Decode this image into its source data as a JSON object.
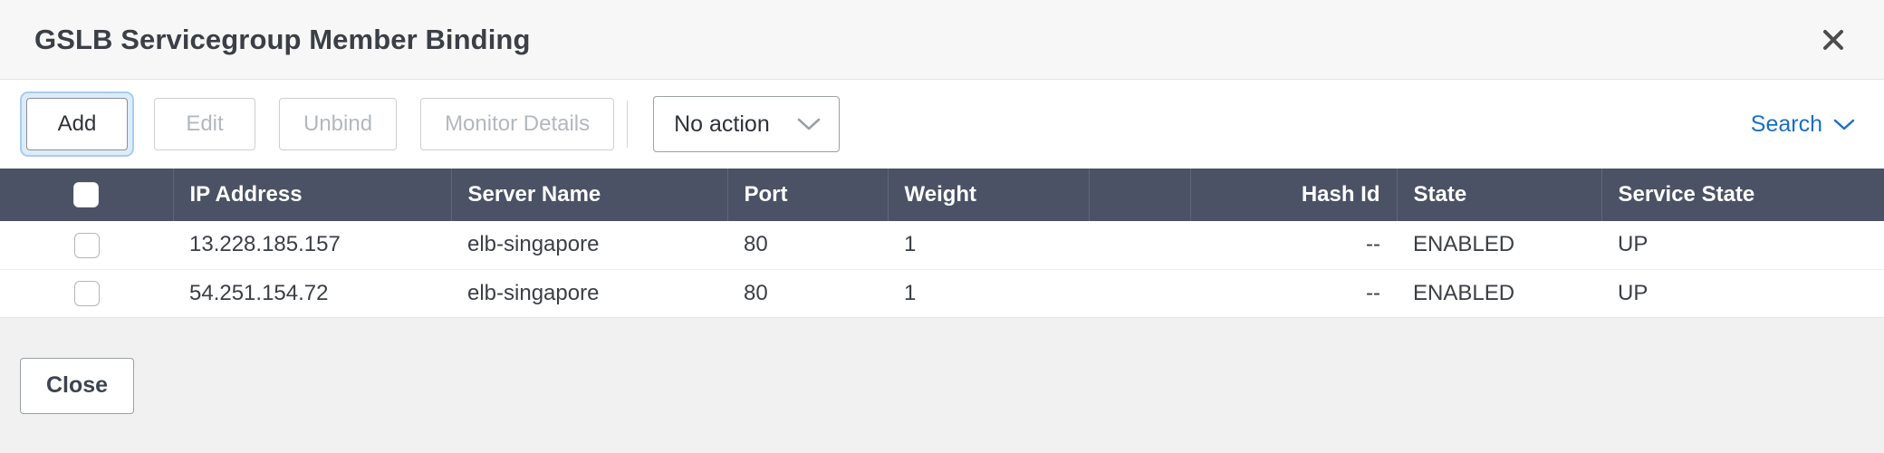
{
  "dialog": {
    "title": "GSLB Servicegroup Member Binding",
    "close_icon": "close-icon"
  },
  "toolbar": {
    "add_label": "Add",
    "edit_label": "Edit",
    "unbind_label": "Unbind",
    "monitor_details_label": "Monitor Details",
    "action_select_value": "No action",
    "action_select_options": [
      "No action"
    ],
    "search_label": "Search",
    "search_chevron_icon": "chevron-down-icon",
    "select_chevron_icon": "chevron-down-icon"
  },
  "table": {
    "columns": [
      {
        "key": "select",
        "label": "",
        "align": "center"
      },
      {
        "key": "ip_address",
        "label": "IP Address",
        "align": "left"
      },
      {
        "key": "server_name",
        "label": "Server Name",
        "align": "left"
      },
      {
        "key": "port",
        "label": "Port",
        "align": "left"
      },
      {
        "key": "weight",
        "label": "Weight",
        "align": "left"
      },
      {
        "key": "blank",
        "label": "",
        "align": "left"
      },
      {
        "key": "hash_id",
        "label": "Hash Id",
        "align": "right"
      },
      {
        "key": "state",
        "label": "State",
        "align": "left"
      },
      {
        "key": "service_state",
        "label": "Service State",
        "align": "left"
      }
    ],
    "header_select_all": false,
    "rows": [
      {
        "selected": false,
        "ip_address": "13.228.185.157",
        "server_name": "elb-singapore",
        "port": "80",
        "weight": "1",
        "blank": "",
        "hash_id": "--",
        "state": "ENABLED",
        "service_state": "UP"
      },
      {
        "selected": false,
        "ip_address": "54.251.154.72",
        "server_name": "elb-singapore",
        "port": "80",
        "weight": "1",
        "blank": "",
        "hash_id": "--",
        "state": "ENABLED",
        "service_state": "UP"
      }
    ]
  },
  "footer": {
    "close_label": "Close"
  },
  "colors": {
    "header_bg": "#4b5265",
    "titlebar_bg": "#f7f7f7",
    "footer_bg": "#f1f1f1",
    "link": "#1a6fc4",
    "focus_ring": "#a8cdf0",
    "disabled_text": "#b4b8bd"
  }
}
